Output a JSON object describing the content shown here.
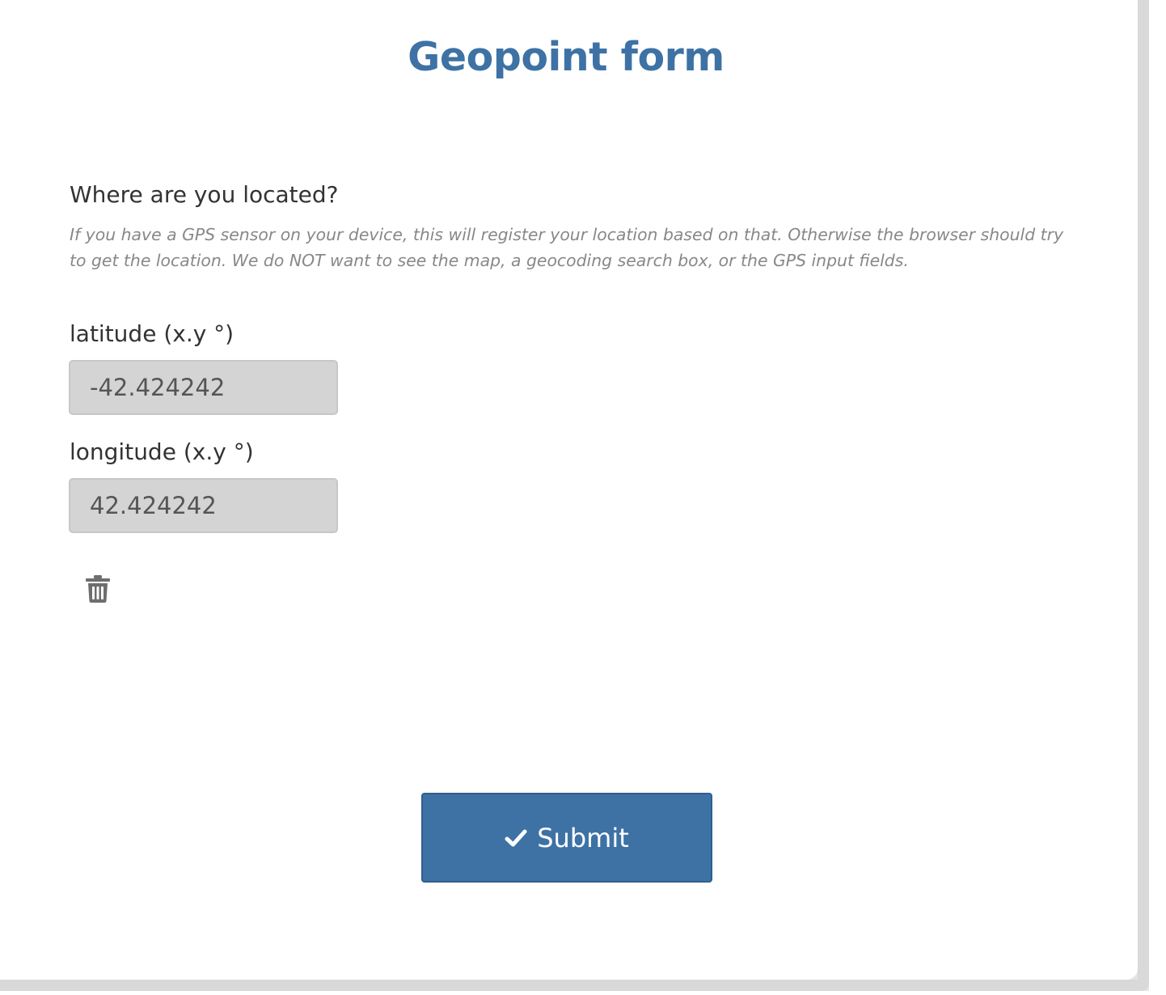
{
  "form": {
    "title": "Geopoint form"
  },
  "question": {
    "label": "Where are you located?",
    "hint": "If you have a GPS sensor on your device, this will register your location based on that. Otherwise the browser should try to get the location. We do NOT want to see the map, a geocoding search box, or the GPS input fields."
  },
  "latitude": {
    "label": "latitude (x.y °)",
    "value": "-42.424242"
  },
  "longitude": {
    "label": "longitude (x.y °)",
    "value": "42.424242"
  },
  "actions": {
    "delete_icon": "trash-icon",
    "submit_icon": "checkmark-icon",
    "submit_label": "Submit"
  },
  "colors": {
    "accent": "#3e72a5",
    "input_bg": "#d4d4d4",
    "hint_text": "#888888",
    "body_text": "#333333"
  }
}
